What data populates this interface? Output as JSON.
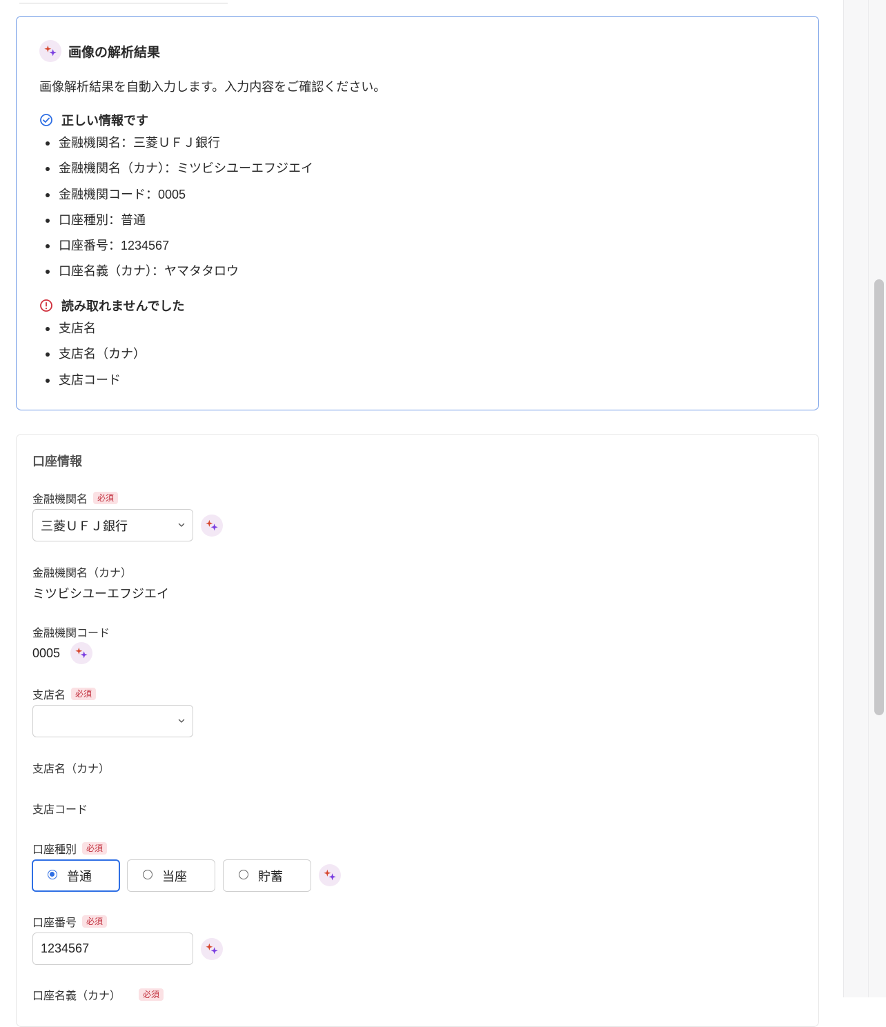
{
  "ai_result": {
    "title": "画像の解析結果",
    "description": "画像解析結果を自動入力します。入力内容をご確認ください。",
    "correct_heading": "正しい情報です",
    "correct_items": [
      "金融機関名：三菱ＵＦＪ銀行",
      "金融機関名（カナ）：ミツビシユーエフジエイ",
      "金融機関コード：0005",
      "口座種別：普通",
      "口座番号：1234567",
      "口座名義（カナ）：ヤマタタロウ"
    ],
    "unread_heading": "読み取れませんでした",
    "unread_items": [
      "支店名",
      "支店名（カナ）",
      "支店コード"
    ]
  },
  "account_form": {
    "title": "口座情報",
    "required_badge": "必須",
    "bank_name_label": "金融機関名",
    "bank_name_value": "三菱ＵＦＪ銀行",
    "bank_kana_label": "金融機関名（カナ）",
    "bank_kana_value": "ミツビシユーエフジエイ",
    "bank_code_label": "金融機関コード",
    "bank_code_value": "0005",
    "branch_name_label": "支店名",
    "branch_name_value": "",
    "branch_kana_label": "支店名（カナ）",
    "branch_code_label": "支店コード",
    "account_type_label": "口座種別",
    "account_type_options": [
      "普通",
      "当座",
      "貯蓄"
    ],
    "account_type_selected": "普通",
    "account_number_label": "口座番号",
    "account_number_value": "1234567",
    "account_holder_label": "口座名義（カナ）"
  },
  "colors": {
    "accent_blue": "#2f6fe4",
    "ai_card_border": "#6f9ae6",
    "required_bg": "#fbe1e4",
    "required_text": "#c2323f",
    "error_red": "#d0303d",
    "sparkle_bg": "#f3e8f5"
  },
  "icons": {
    "ai_sparkle": "sparkle-icon",
    "correct": "check-circle-icon",
    "unread": "exclamation-circle-icon",
    "dropdown": "chevron-down-icon"
  }
}
